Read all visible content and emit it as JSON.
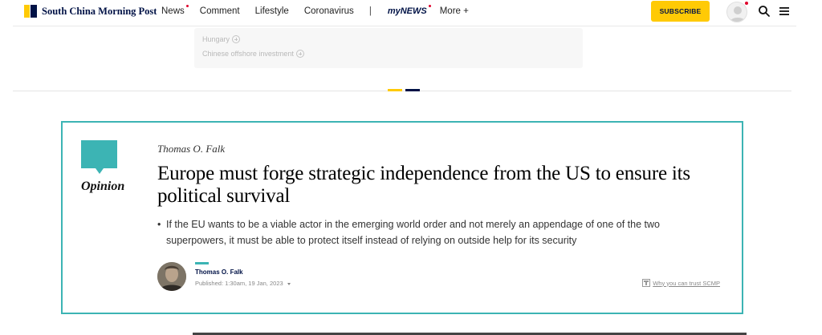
{
  "brand": {
    "name": "South China Morning Post",
    "colors": {
      "yellow": "#ffca05",
      "navy": "#001246",
      "teal": "#3cb4b4",
      "alert": "#e0002a"
    }
  },
  "nav": {
    "items": [
      {
        "label": "News",
        "has_dot": true
      },
      {
        "label": "Comment",
        "has_dot": false
      },
      {
        "label": "Lifestyle",
        "has_dot": false
      },
      {
        "label": "Coronavirus",
        "has_dot": false
      }
    ],
    "separator": "|",
    "mynews_label": "myNEWS",
    "more_label": "More +",
    "subscribe_label": "SUBSCRIBE",
    "icons": [
      "user-avatar-icon",
      "search-icon",
      "hamburger-menu-icon"
    ]
  },
  "topics": {
    "items": [
      {
        "label": "Hungary"
      },
      {
        "label": "Chinese offshore investment"
      }
    ]
  },
  "opinion_card": {
    "section_label": "Opinion",
    "author_top": "Thomas O. Falk",
    "headline": "Europe must forge strategic independence from the US to ensure its political survival",
    "summary_bullet": "•",
    "summary": "If the EU wants to be a viable actor in the emerging world order and not merely an appendage of one of the two superpowers, it must be able to protect itself instead of relying on outside help for its security",
    "byline": {
      "author": "Thomas O. Falk",
      "published": "Published: 1:30am, 19 Jan, 2023"
    },
    "trust_link": "Why you can trust SCMP"
  }
}
